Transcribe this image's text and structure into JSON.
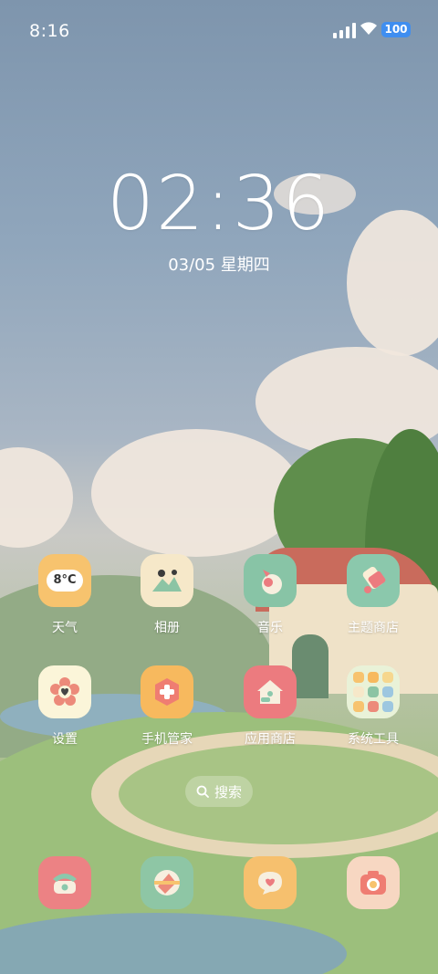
{
  "status": {
    "time": "8:16",
    "battery": "100"
  },
  "lock": {
    "clock": "02:36",
    "date": "03/05 星期四"
  },
  "apps": [
    {
      "label": "天气",
      "icon": "weather-icon",
      "icon_text": "8°C",
      "color": "#f7c36e"
    },
    {
      "label": "相册",
      "icon": "gallery-icon",
      "color": "#f6e8c9"
    },
    {
      "label": "音乐",
      "icon": "music-icon",
      "color": "#88c4a6"
    },
    {
      "label": "主题商店",
      "icon": "theme-store-icon",
      "color": "#8bc8ac"
    },
    {
      "label": "设置",
      "icon": "settings-icon",
      "color": "#fbf5d9"
    },
    {
      "label": "手机管家",
      "icon": "phone-manager-icon",
      "color": "#f7b95e"
    },
    {
      "label": "应用商店",
      "icon": "app-store-icon",
      "color": "#ec7b7f"
    },
    {
      "label": "系统工具",
      "icon": "system-tools-folder-icon",
      "color": "#e9f2d8"
    }
  ],
  "search": {
    "label": "搜索",
    "icon": "search-icon"
  },
  "dock": [
    {
      "icon": "phone-icon",
      "color": "#ec8284"
    },
    {
      "icon": "browser-icon",
      "color": "#8ec6a5"
    },
    {
      "icon": "messages-icon",
      "color": "#f6c06e"
    },
    {
      "icon": "camera-icon",
      "color": "#f7d7c2"
    }
  ]
}
